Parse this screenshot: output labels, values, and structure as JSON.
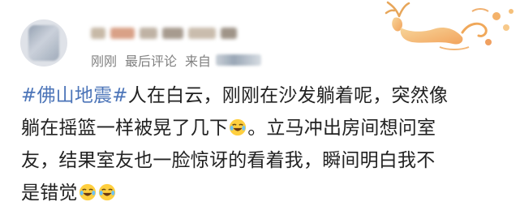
{
  "post": {
    "meta": {
      "time": "刚刚",
      "action": "最后评论",
      "source_prefix": "来自"
    },
    "content": {
      "hashtag": "#佛山地震#",
      "line1_text": "人在白云，刚刚在沙发躺着呢，突然像",
      "line2_text": "躺在摇篮一样被晃了几下",
      "line2_tail": "。立马冲出房间想问室",
      "line3_text": "友，结果室友也一脸惊讶的看着我，瞬间明白我不",
      "line4_text": "是错觉"
    },
    "emoji": {
      "name": "laugh-cry-emoji"
    }
  },
  "colors": {
    "hashtag": "#4b74b8",
    "text": "#222222",
    "meta": "#808080"
  }
}
